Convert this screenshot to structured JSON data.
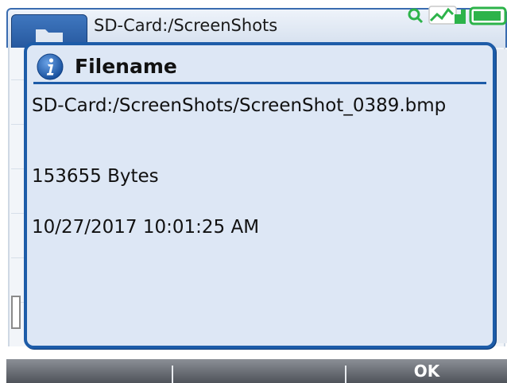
{
  "header": {
    "path_title": "SD-Card:/ScreenShots"
  },
  "dialog": {
    "title": "Filename",
    "icon": "info-icon",
    "file_path": "SD-Card:/ScreenShots/ScreenShot_0389.bmp",
    "file_size": "153655 Bytes",
    "file_date": "10/27/2017 10:01:25 AM"
  },
  "softkeys": {
    "key1": "",
    "key2": "",
    "key3": "OK"
  },
  "status_icons": [
    "search-icon",
    "signal-icon",
    "battery-icon"
  ],
  "colors": {
    "dialog_border": "#1d5ca8",
    "dialog_bg": "#dde7f5",
    "status_green": "#2db34a"
  }
}
